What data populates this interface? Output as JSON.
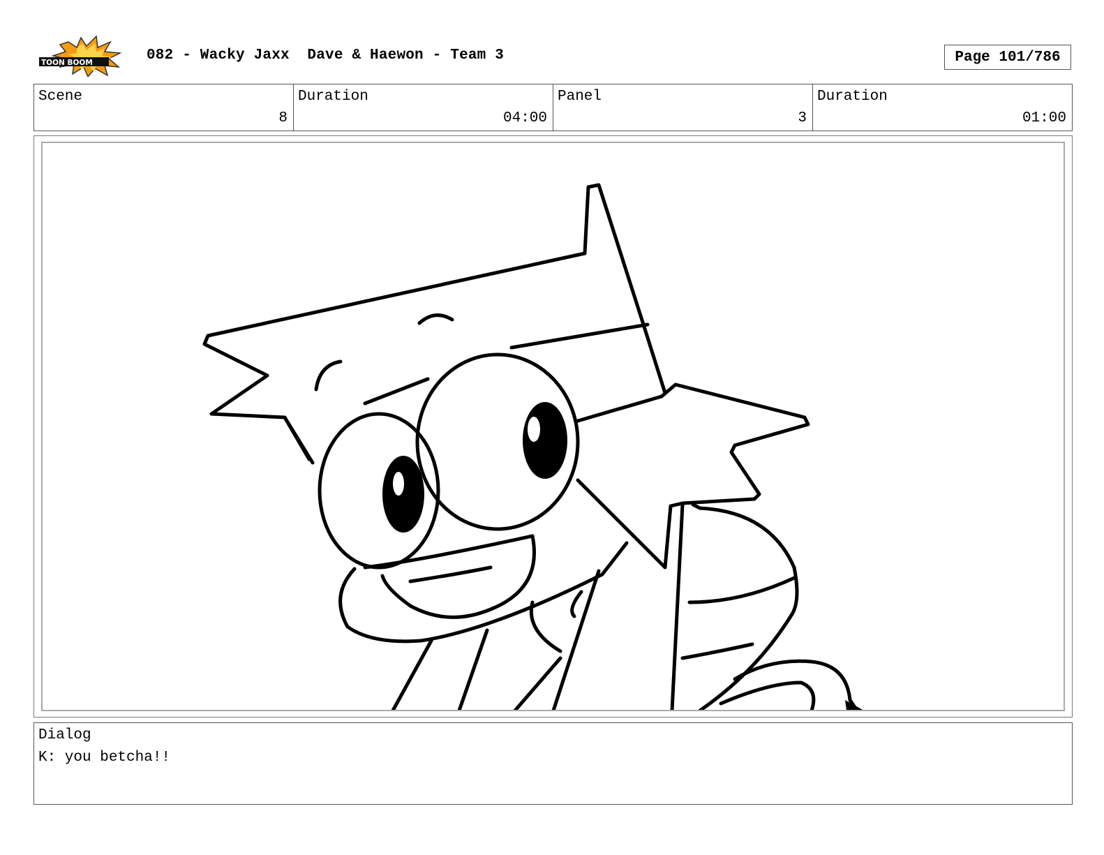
{
  "header": {
    "logo": {
      "name": "toonboom-logo",
      "text": "TOON BOOM",
      "colors": {
        "burst": "#f39c12",
        "burst_outline": "#333333",
        "banner": "#111111"
      }
    },
    "title": "082 - Wacky Jaxx  Dave & Haewon - Team 3",
    "page": "Page 101/786"
  },
  "info": {
    "scene_label": "Scene",
    "scene_value": "8",
    "scene_duration_label": "Duration",
    "scene_duration_value": "04:00",
    "panel_label": "Panel",
    "panel_value": "3",
    "panel_duration_label": "Duration",
    "panel_duration_value": "01:00"
  },
  "panel": {
    "image": "sketch-character-big-eyes-leaning-in"
  },
  "dialog": {
    "label": "Dialog",
    "text": "K: you betcha!!"
  }
}
